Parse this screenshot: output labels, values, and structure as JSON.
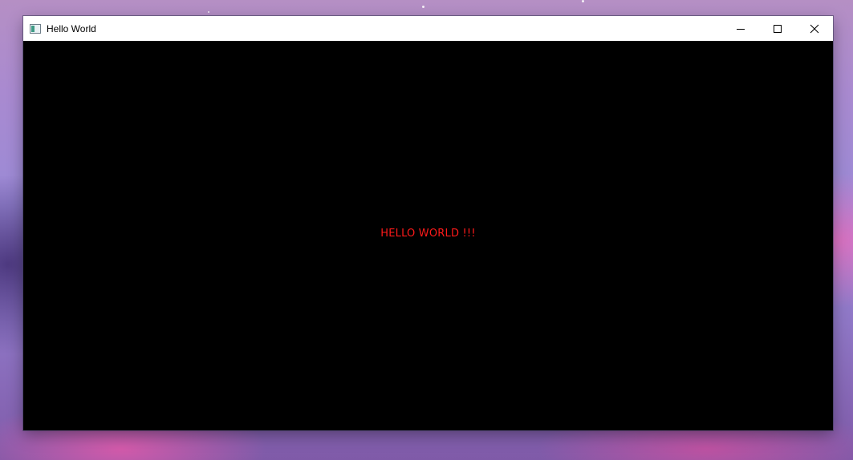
{
  "window": {
    "title": "Hello World",
    "icon": "app-window-icon",
    "controls": {
      "minimize": "minimize-icon",
      "maximize": "maximize-icon",
      "close": "close-icon"
    }
  },
  "canvas": {
    "text": "HELLO WORLD !!!",
    "text_color": "#ff1a1a",
    "background": "#000000"
  }
}
